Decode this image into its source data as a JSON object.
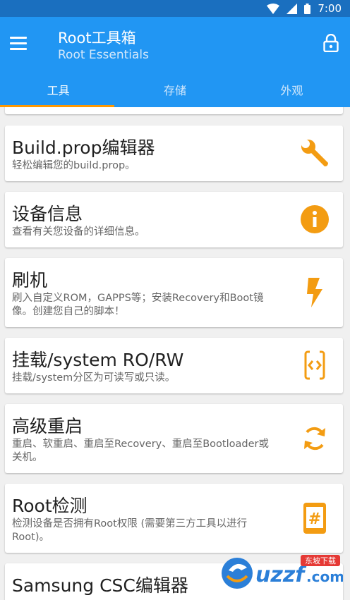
{
  "status": {
    "time": "7:00"
  },
  "appbar": {
    "title": "Root工具箱",
    "subtitle": "Root Essentials"
  },
  "tabs": [
    {
      "label": "工具",
      "active": true
    },
    {
      "label": "存储",
      "active": false
    },
    {
      "label": "外观",
      "active": false
    }
  ],
  "items": [
    {
      "title": "Build.prop编辑器",
      "desc": "轻松编辑您的build.prop。",
      "icon": "wrench-icon"
    },
    {
      "title": "设备信息",
      "desc": "查看有关您设备的详细信息。",
      "icon": "info-icon"
    },
    {
      "title": "刷机",
      "desc": "刷入自定义ROM，GAPPS等；安装Recovery和Boot镜像。创建您自己的脚本！",
      "icon": "flash-icon"
    },
    {
      "title": "挂载/system RO/RW",
      "desc": "挂载/system分区为可读写或只读。",
      "icon": "mount-icon"
    },
    {
      "title": "高级重启",
      "desc": "重启、软重启、重启至Recovery、重启至Bootloader或关机。",
      "icon": "reboot-icon"
    },
    {
      "title": "Root检测",
      "desc": "检测设备是否拥有Root权限 (需要第三方工具以进行Root)。",
      "icon": "root-check-icon"
    },
    {
      "title": "Samsung CSC编辑器",
      "desc": "",
      "icon": ""
    }
  ],
  "watermark": {
    "text": "uzzf.com",
    "sub": "东坡下载"
  },
  "colors": {
    "primary": "#2196f3",
    "statusbar": "#1a6fbf",
    "accent": "#ff9800",
    "icon": "#f39c12"
  }
}
